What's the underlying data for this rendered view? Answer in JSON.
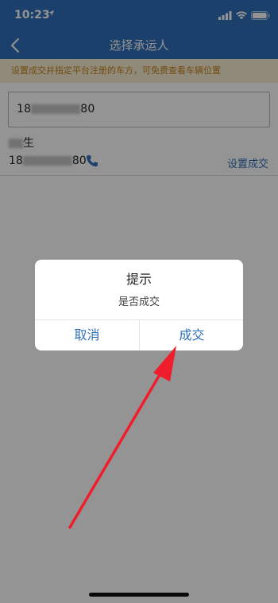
{
  "status_bar": {
    "time": "10:23",
    "icons": [
      "location-arrow-icon",
      "signal-icon",
      "wifi-icon",
      "battery-icon"
    ]
  },
  "nav": {
    "title": "选择承运人",
    "back_icon": "chevron-left-icon"
  },
  "notice": {
    "text": "设置成交并指定平台注册的车方，可免费查看车辆位置"
  },
  "search": {
    "value_prefix": "18",
    "value_suffix": "80"
  },
  "contact": {
    "name_suffix": "生",
    "phone_prefix": "18",
    "phone_suffix": "80",
    "call_icon": "phone-icon",
    "action_label": "设置成交"
  },
  "dialog": {
    "title": "提示",
    "message": "是否成交",
    "cancel_label": "取消",
    "confirm_label": "成交"
  },
  "colors": {
    "brand": "#2d6fb8",
    "notice_bg": "#f7eed0",
    "notice_text": "#c8841e",
    "annotation_arrow": "#f01e2c"
  }
}
